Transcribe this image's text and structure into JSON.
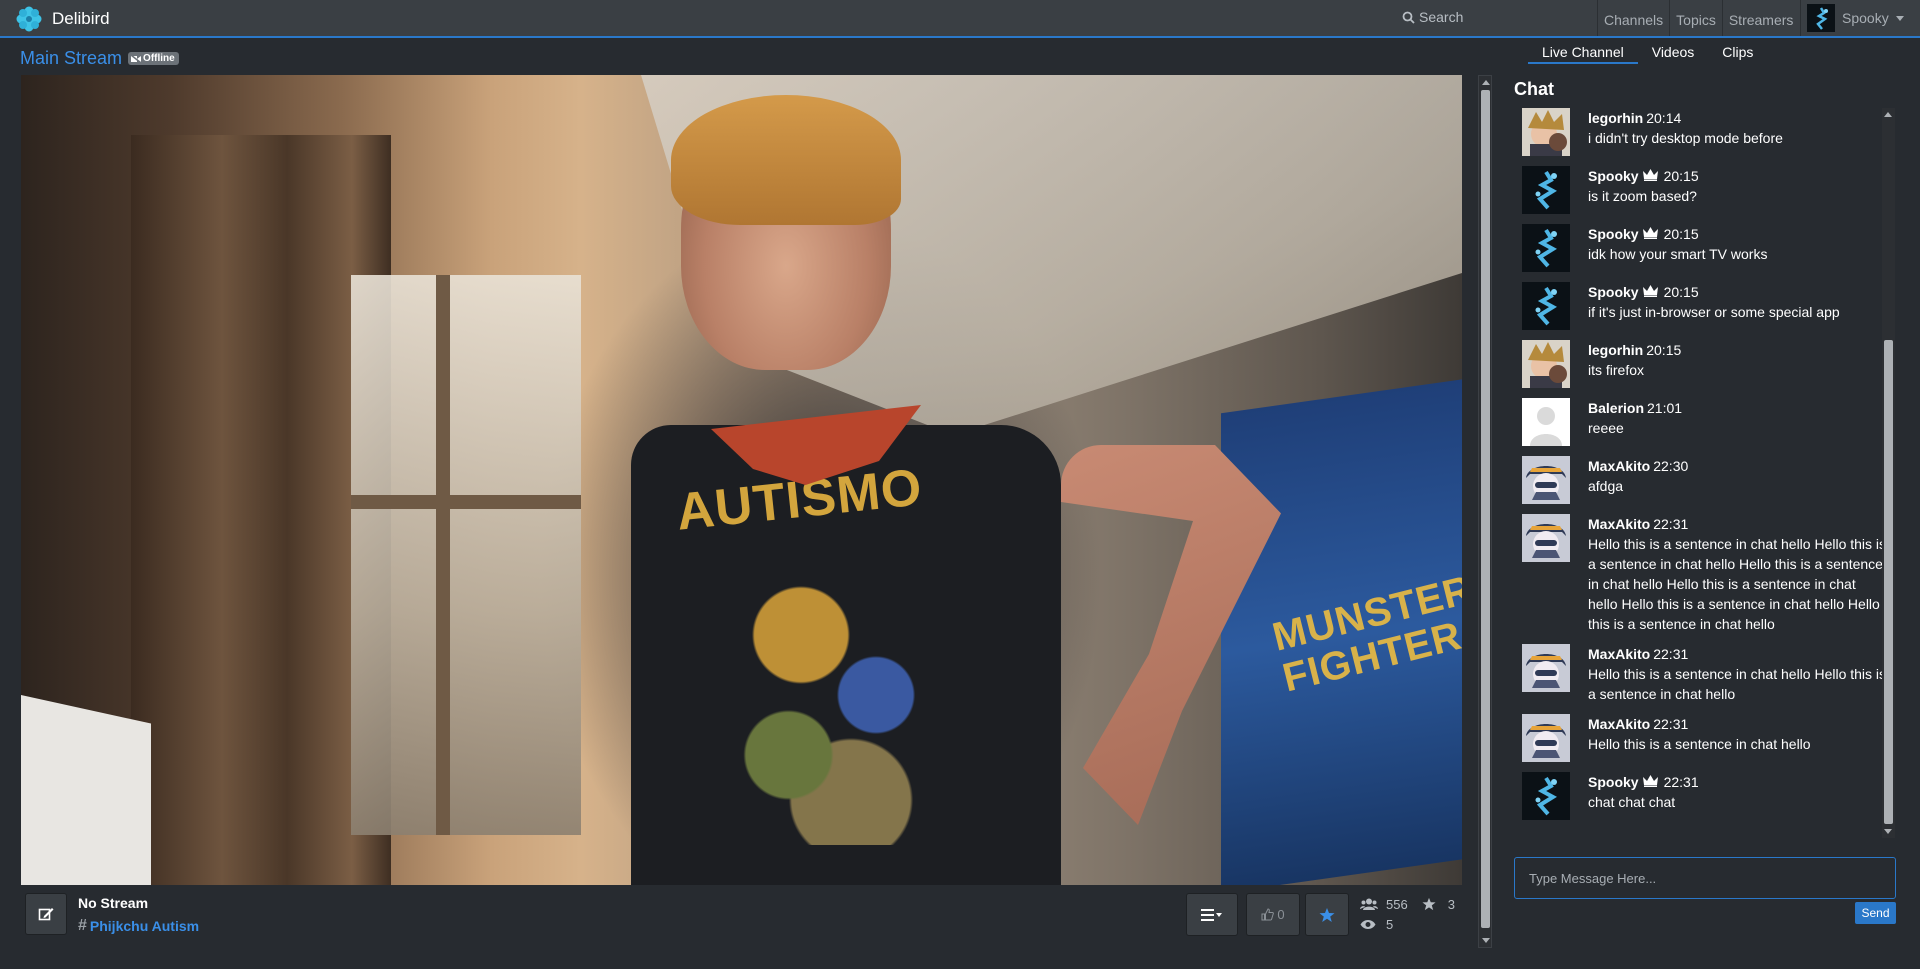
{
  "app": {
    "name": "Delibird"
  },
  "nav": {
    "search_label": "Search",
    "links": [
      "Channels",
      "Topics",
      "Streamers"
    ],
    "user": "Spooky"
  },
  "stream": {
    "title": "Main Stream",
    "status_badge": "Offline",
    "name": "No Stream",
    "topic": "Phijkchu Autism",
    "likes": "0",
    "viewers": "556",
    "favorites": "3",
    "watching": "5"
  },
  "video": {
    "shirt_text": "AUTISMO",
    "poster_text": "MUNSTER FIGHTER"
  },
  "tabs": [
    "Live Channel",
    "Videos",
    "Clips"
  ],
  "chat": {
    "heading": "Chat",
    "messages": [
      {
        "user": "legorhin",
        "mod": false,
        "avatar": "legorhin",
        "time": "20:14",
        "text": "i didn't try desktop mode before"
      },
      {
        "user": "Spooky",
        "mod": true,
        "avatar": "spooky",
        "time": "20:15",
        "text": "is it zoom based?"
      },
      {
        "user": "Spooky",
        "mod": true,
        "avatar": "spooky",
        "time": "20:15",
        "text": "idk how your smart TV works"
      },
      {
        "user": "Spooky",
        "mod": true,
        "avatar": "spooky",
        "time": "20:15",
        "text": "if it's just in-browser or some special app"
      },
      {
        "user": "legorhin",
        "mod": false,
        "avatar": "legorhin",
        "time": "20:15",
        "text": "its firefox"
      },
      {
        "user": "Balerion",
        "mod": false,
        "avatar": "default",
        "time": "21:01",
        "text": "reeee"
      },
      {
        "user": "MaxAkito",
        "mod": false,
        "avatar": "maxakito",
        "time": "22:30",
        "text": "afdga"
      },
      {
        "user": "MaxAkito",
        "mod": false,
        "avatar": "maxakito",
        "time": "22:31",
        "text": "Hello this is a sentence in chat hello Hello this is a sentence in chat hello Hello this is a sentence in chat hello Hello this is a sentence in chat hello Hello this is a sentence in chat hello Hello this is a sentence in chat hello"
      },
      {
        "user": "MaxAkito",
        "mod": false,
        "avatar": "maxakito",
        "time": "22:31",
        "text": "Hello this is a sentence in chat hello Hello this is a sentence in chat hello"
      },
      {
        "user": "MaxAkito",
        "mod": false,
        "avatar": "maxakito",
        "time": "22:31",
        "text": "Hello this is a sentence in chat hello"
      },
      {
        "user": "Spooky",
        "mod": true,
        "avatar": "spooky",
        "time": "22:31",
        "text": "chat chat chat"
      }
    ],
    "input_placeholder": "Type Message Here...",
    "send_label": "Send"
  },
  "colors": {
    "accent": "#2a78c9",
    "link": "#3a8fe8",
    "background": "#272b30",
    "navbar": "#3a3f44"
  }
}
